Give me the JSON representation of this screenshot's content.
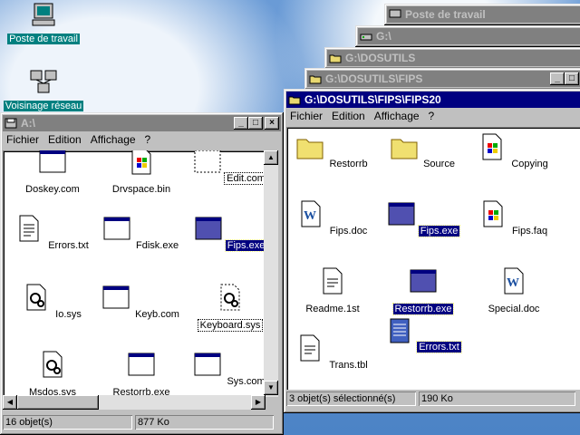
{
  "desktop": {
    "icons": [
      {
        "label": "Poste de travail"
      },
      {
        "label": "Voisinage réseau"
      }
    ]
  },
  "background_windows": [
    {
      "title": "Poste de travail"
    },
    {
      "title": "G:\\"
    },
    {
      "title": "G:\\DOSUTILS"
    },
    {
      "title": "G:\\DOSUTILS\\FIPS"
    }
  ],
  "left_window": {
    "title": "A:\\",
    "menu": [
      "Fichier",
      "Edition",
      "Affichage",
      "?"
    ],
    "files": [
      {
        "name": "Doskey.com"
      },
      {
        "name": "Drvspace.bin"
      },
      {
        "name": "Edit.com"
      },
      {
        "name": "Errors.txt"
      },
      {
        "name": "Fdisk.exe"
      },
      {
        "name": "Fips.exe"
      },
      {
        "name": "Io.sys"
      },
      {
        "name": "Keyb.com"
      },
      {
        "name": "Keyboard.sys"
      },
      {
        "name": "Msdos.sys"
      },
      {
        "name": "Restorrb.exe"
      },
      {
        "name": "Sys.com"
      }
    ],
    "status": {
      "count": "16 objet(s)",
      "size": "877 Ko"
    }
  },
  "right_window": {
    "title": "G:\\DOSUTILS\\FIPS\\FIPS20",
    "menu": [
      "Fichier",
      "Edition",
      "Affichage",
      "?"
    ],
    "files": [
      {
        "name": "Restorrb"
      },
      {
        "name": "Source"
      },
      {
        "name": "Copying"
      },
      {
        "name": "Fips.doc"
      },
      {
        "name": "Fips.exe"
      },
      {
        "name": "Fips.faq"
      },
      {
        "name": "Readme.1st"
      },
      {
        "name": "Restorrb.exe"
      },
      {
        "name": "Special.doc"
      },
      {
        "name": "Trans.tbl"
      },
      {
        "name": "Errors.txt"
      }
    ],
    "status": {
      "selected": "3 objet(s) sélectionné(s)",
      "size": "190 Ko"
    }
  },
  "colors": {
    "titlebar_active": "#000080",
    "titlebar_inactive": "#808080",
    "desktop_label_bg": "#008080"
  }
}
